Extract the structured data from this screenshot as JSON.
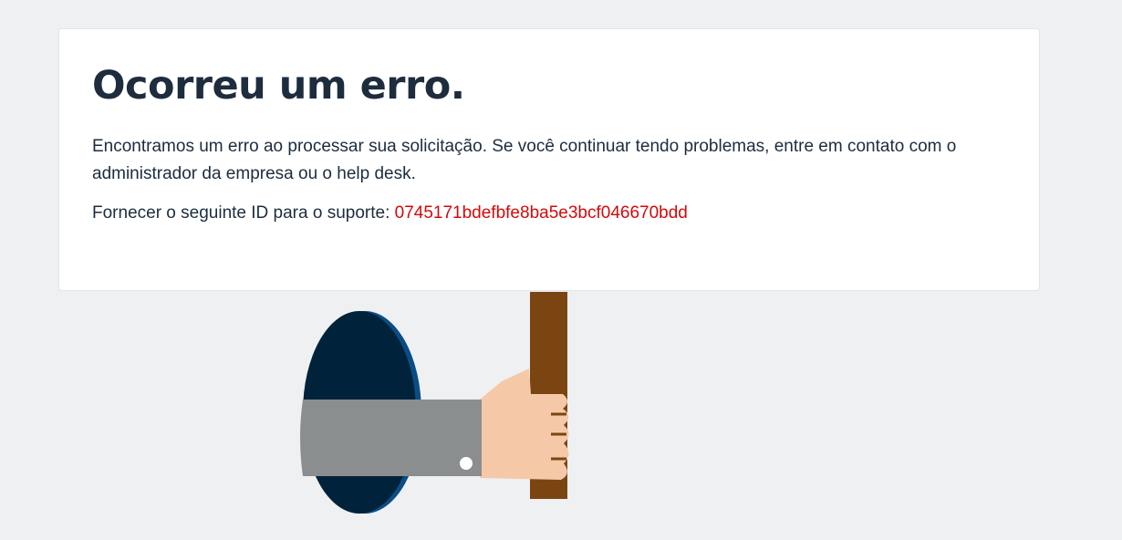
{
  "error_card": {
    "title": "Ocorreu um erro.",
    "message": "Encontramos um erro ao processar sua solicitação. Se você continuar tendo problemas, entre em contato com o administrador da empresa ou o help desk.",
    "support_label": "Fornecer o seguinte ID para o suporte:",
    "support_id": "0745171bdefbfe8ba5e3bcf046670bdd"
  },
  "colors": {
    "background": "#eff0f2",
    "card": "#ffffff",
    "text": "#1d2d3e",
    "support_id": "#d20a0a",
    "hole_dark": "#00223a",
    "hole_rim": "#0a4d85",
    "sleeve": "#8a8e8f",
    "skin": "#f5c9a8",
    "sign_post": "#7b4511"
  },
  "illustration": {
    "icon": "hand-holding-sign-from-hole-illustration"
  }
}
